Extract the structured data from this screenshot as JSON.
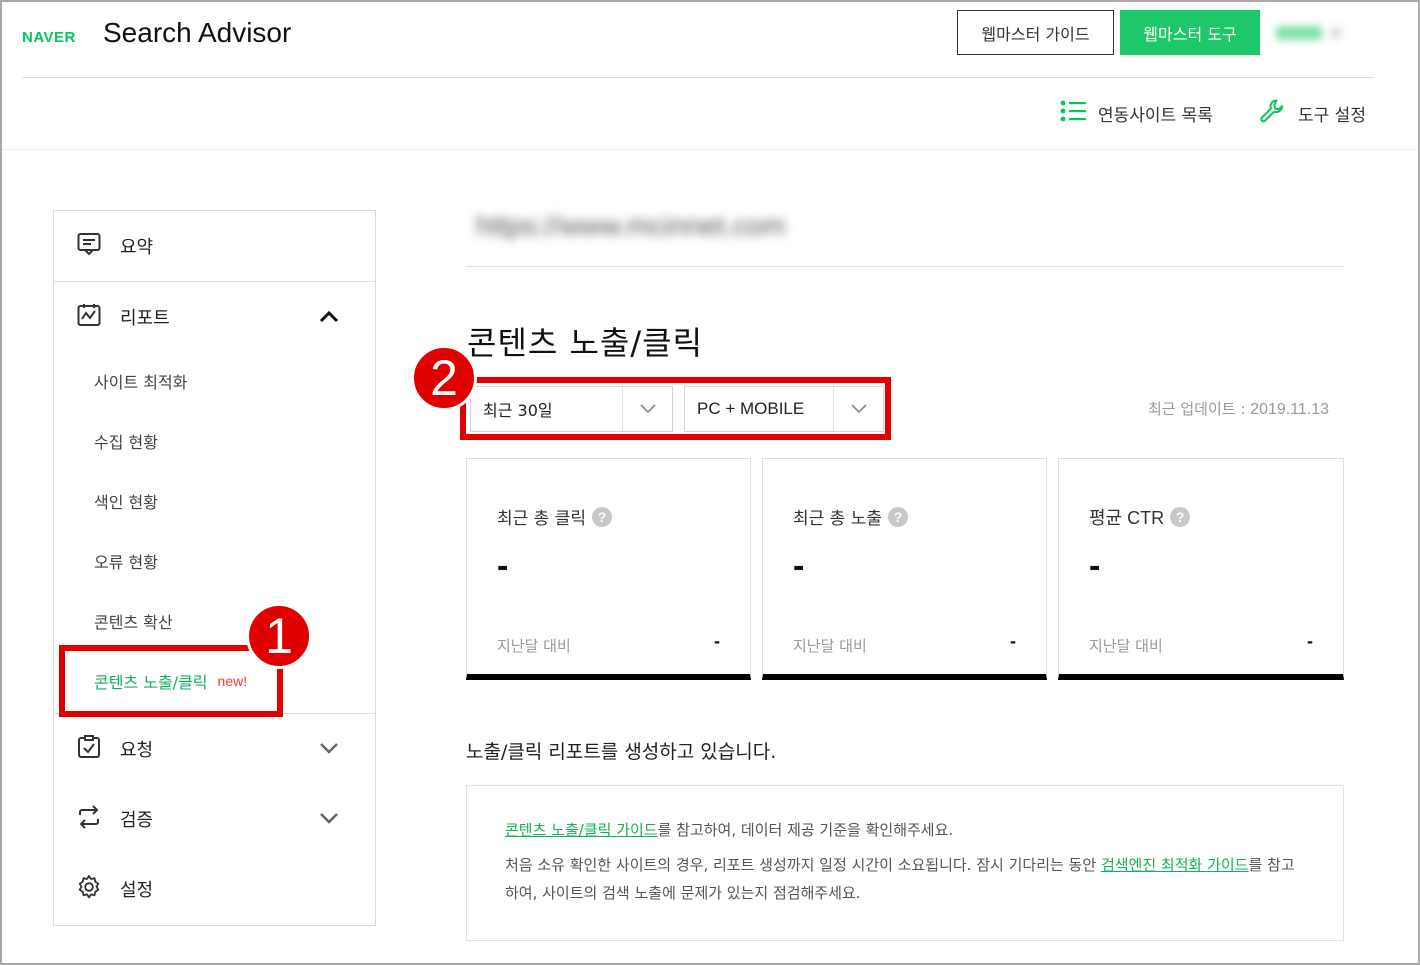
{
  "header": {
    "logo": "NAVER",
    "title": "Search Advisor",
    "guide_label": "웹마스터 가이드",
    "tool_label": "웹마스터 도구",
    "sites_label": "연동사이트 목록",
    "settings_label": "도구 설정",
    "brand_color": "#03c75a"
  },
  "sidebar": {
    "summary": "요약",
    "report": "리포트",
    "report_items": [
      "사이트 최적화",
      "수집 현황",
      "색인 현황",
      "오류 현황",
      "콘텐츠 확산"
    ],
    "active_item": "콘텐츠 노출/클릭",
    "new_badge": "new!",
    "request": "요청",
    "verify": "검증",
    "settings": "설정"
  },
  "main": {
    "site_url": "https://www.mcinnet.com",
    "page_title": "콘텐츠 노출/클릭",
    "period_value": "최근 30일",
    "device_value": "PC + MOBILE",
    "updated_label": "최근 업데이트 : ",
    "updated_date": "2019.11.13",
    "cards": [
      {
        "label": "최근 총 클릭",
        "value": "-",
        "compare_label": "지난달 대비",
        "compare_value": "-"
      },
      {
        "label": "최근 총 노출",
        "value": "-",
        "compare_label": "지난달 대비",
        "compare_value": "-"
      },
      {
        "label": "평균 CTR",
        "value": "-",
        "compare_label": "지난달 대비",
        "compare_value": "-"
      }
    ],
    "qmark": "?",
    "status_msg": "노출/클릭 리포트를 생성하고 있습니다.",
    "notice": {
      "link1": "콘텐츠 노출/클릭 가이드",
      "text1": "를 참고하여, 데이터 제공 기준을 확인해주세요.",
      "text2": "처음 소유 확인한 사이트의 경우, 리포트 생성까지 일정 시간이 소요됩니다. 잠시 기다리는 동안 ",
      "link2": "검색엔진 최적화 가이드",
      "text3": "를 참고하여, 사이트의 검색 노출에 문제가 있는지 점검해주세요."
    }
  },
  "annotations": {
    "badge1": "1",
    "badge2": "2",
    "highlight_color": "#e00000"
  }
}
